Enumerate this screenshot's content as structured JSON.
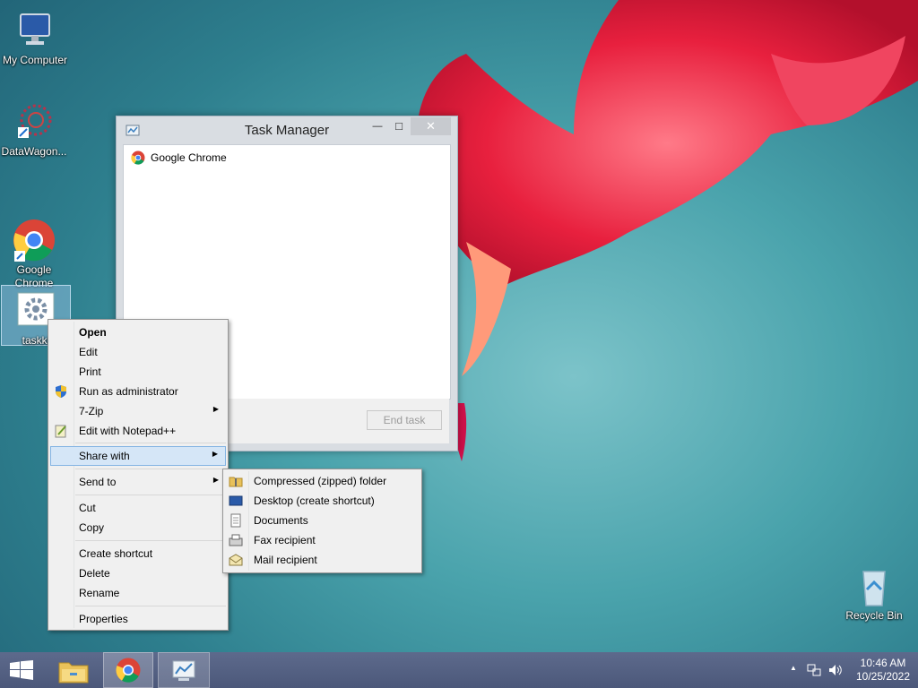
{
  "desktop": {
    "icons": [
      {
        "label": "My Computer"
      },
      {
        "label": "DataWagon..."
      },
      {
        "label": "Google\nChrome"
      },
      {
        "label": "taskki"
      },
      {
        "label": "Recycle Bin"
      }
    ]
  },
  "task_manager": {
    "title": "Task Manager",
    "minimize": "—",
    "maximize": "□",
    "close": "✕",
    "apps": [
      {
        "name": "Google Chrome",
        "icon": "chrome-icon"
      }
    ],
    "end_task": "End task"
  },
  "context_menu": {
    "items": [
      {
        "label": "Open",
        "bold": true
      },
      {
        "label": "Edit"
      },
      {
        "label": "Print"
      },
      {
        "label": "Run as administrator",
        "icon": "uac-shield-icon"
      },
      {
        "label": "7-Zip",
        "submenu": true
      },
      {
        "label": "Edit with Notepad++",
        "icon": "notepadpp-icon"
      },
      {
        "label": "Share with",
        "submenu": true,
        "highlighted": true
      },
      {
        "label": "Send to",
        "submenu": true
      },
      {
        "label": "Cut"
      },
      {
        "label": "Copy"
      },
      {
        "label": "Create shortcut"
      },
      {
        "label": "Delete"
      },
      {
        "label": "Rename"
      },
      {
        "label": "Properties"
      }
    ]
  },
  "send_to_menu": {
    "items": [
      {
        "label": "Compressed (zipped) folder",
        "icon": "zip-folder-icon"
      },
      {
        "label": "Desktop (create shortcut)",
        "icon": "desktop-icon"
      },
      {
        "label": "Documents",
        "icon": "documents-icon"
      },
      {
        "label": "Fax recipient",
        "icon": "fax-icon"
      },
      {
        "label": "Mail recipient",
        "icon": "mail-icon"
      }
    ]
  },
  "taskbar": {
    "clock_time": "10:46 AM",
    "clock_date": "10/25/2022",
    "tray_arrow": "▲",
    "accent": "#4c587a"
  }
}
